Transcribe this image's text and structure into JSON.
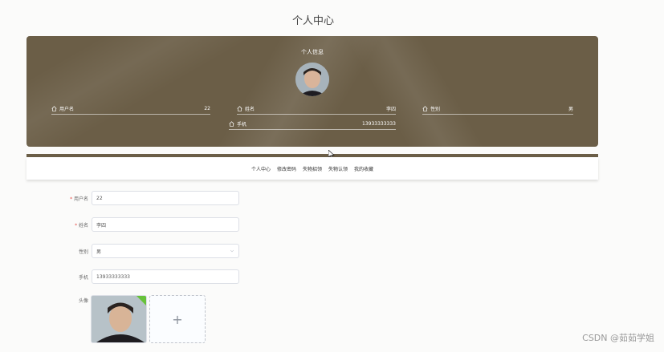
{
  "page": {
    "title": "个人中心"
  },
  "banner": {
    "title": "个人信息",
    "fields": [
      {
        "label": "用户名",
        "value": "22"
      },
      {
        "label": "姓名",
        "value": "李四"
      },
      {
        "label": "性别",
        "value": "男"
      },
      {
        "label": "手机",
        "value": "13933333333"
      }
    ]
  },
  "nav": {
    "items": [
      "个人中心",
      "修改密码",
      "失物招领",
      "失物认领",
      "我的收藏"
    ]
  },
  "form": {
    "username": {
      "label": "用户名",
      "value": "22",
      "required": "*"
    },
    "name": {
      "label": "姓名",
      "value": "李四",
      "required": "*"
    },
    "gender": {
      "label": "性别",
      "value": "男"
    },
    "phone": {
      "label": "手机",
      "value": "13933333333"
    },
    "avatar": {
      "label": "头像",
      "upload_symbol": "+"
    }
  },
  "watermark": "CSDN @茹茹学姐",
  "colors": {
    "accent": "#6b5e47",
    "success": "#67c23a",
    "required": "#e6504a"
  }
}
